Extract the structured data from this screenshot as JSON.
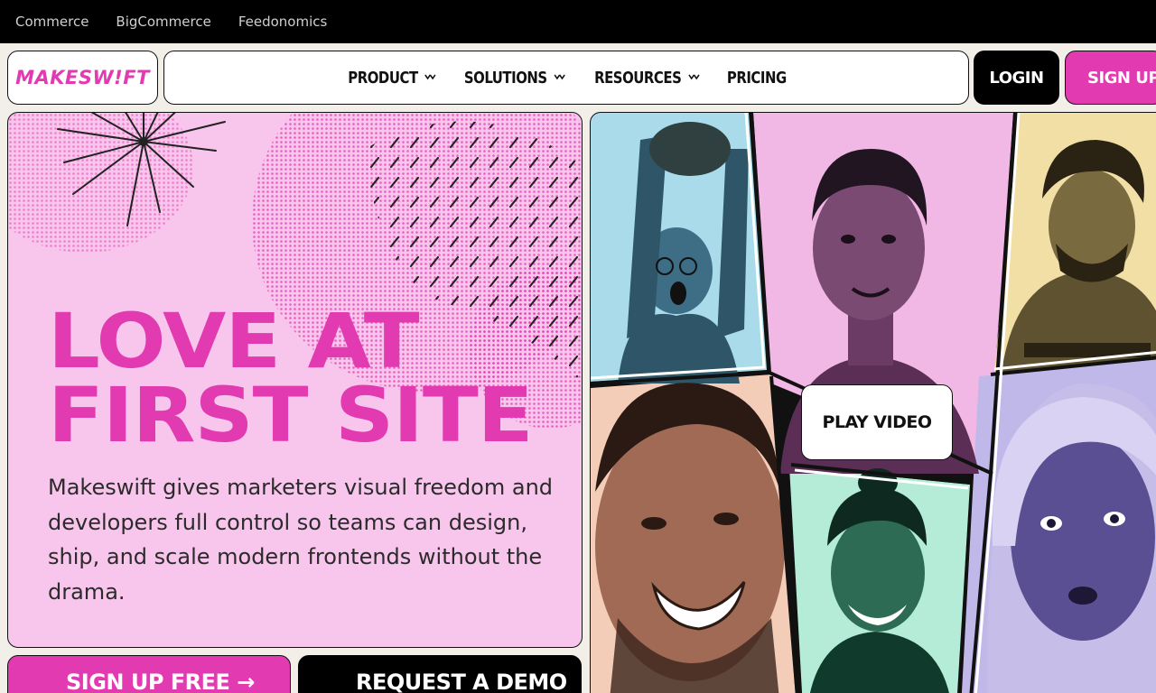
{
  "topbar": {
    "links": [
      "Commerce",
      "BigCommerce",
      "Feedonomics"
    ]
  },
  "nav": {
    "logo": "MAKESW!FT",
    "items": [
      {
        "label": "PRODUCT",
        "icon": "chevron-down-icon"
      },
      {
        "label": "SOLUTIONS",
        "icon": "chevron-down-icon"
      },
      {
        "label": "RESOURCES",
        "icon": "chevron-down-icon"
      },
      {
        "label": "PRICING"
      }
    ],
    "login_label": "LOGIN",
    "signup_label": "SIGN UP"
  },
  "hero": {
    "headline_line1": "LOVE AT",
    "headline_line2": "FIRST SITE",
    "description": "Makeswift gives marketers visual freedom and developers full control so teams can design, ship, and scale modern frontends without the drama.",
    "cta_primary": "SIGN UP FREE →",
    "cta_secondary": "REQUEST A DEMO"
  },
  "collage": {
    "play_label": "PLAY VIDEO"
  },
  "colors": {
    "brand_pink": "#e23ab1",
    "hero_bg": "#f8c6ec",
    "black": "#000000",
    "page_bg": "#f2efe9"
  }
}
